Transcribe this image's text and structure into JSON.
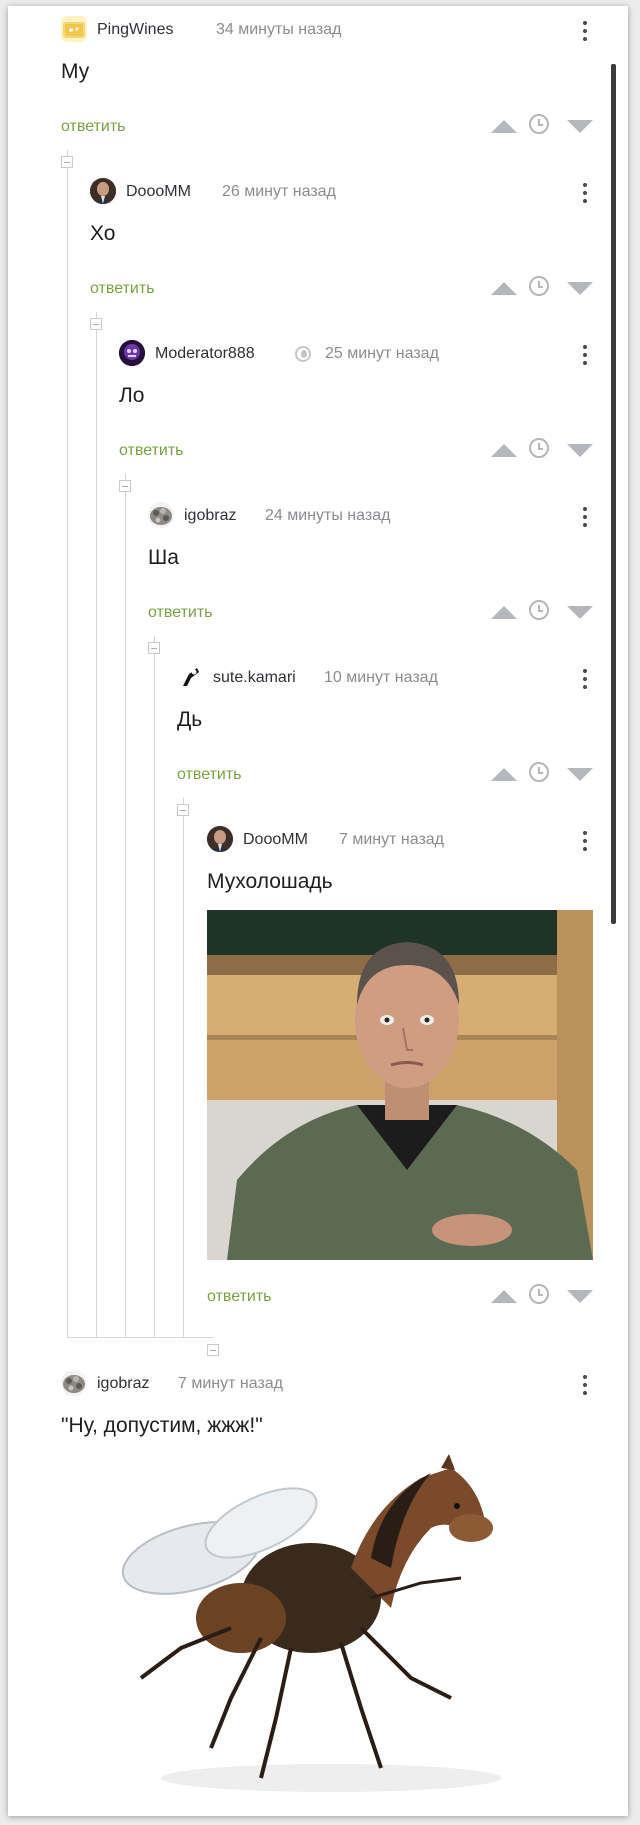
{
  "colors": {
    "reply_green": "#7aa043",
    "meta_gray": "#8a8c90",
    "vote_gray": "#b4b7bb",
    "tree_line": "#d4d6d8"
  },
  "icons": {
    "vote_up": "arrow-up-icon",
    "vote_down": "arrow-down-icon",
    "save": "clock-icon",
    "menu": "more-vertical-icon",
    "collapse": "collapse-minus-icon"
  },
  "comments": [
    {
      "author": "PingWines",
      "time": "34 минуты назад",
      "text": "Му",
      "reply": "ответить"
    },
    {
      "author": "DoooMM",
      "time": "26 минут назад",
      "text": "Хо",
      "reply": "ответить"
    },
    {
      "author": "Moderator888",
      "time": "25 минут назад",
      "text": "Ло",
      "reply": "ответить"
    },
    {
      "author": "igobraz",
      "time": "24 минуты назад",
      "text": "Ша",
      "reply": "ответить"
    },
    {
      "author": "sute.kamari",
      "time": "10 минут назад",
      "text": "Дь",
      "reply": "ответить"
    },
    {
      "author": "DoooMM",
      "time": "7 минут назад",
      "text": "Мухолошадь",
      "reply": "ответить"
    },
    {
      "author": "igobraz",
      "time": "7 минут назад",
      "text": "\"Ну, допустим, жжж!\""
    }
  ]
}
